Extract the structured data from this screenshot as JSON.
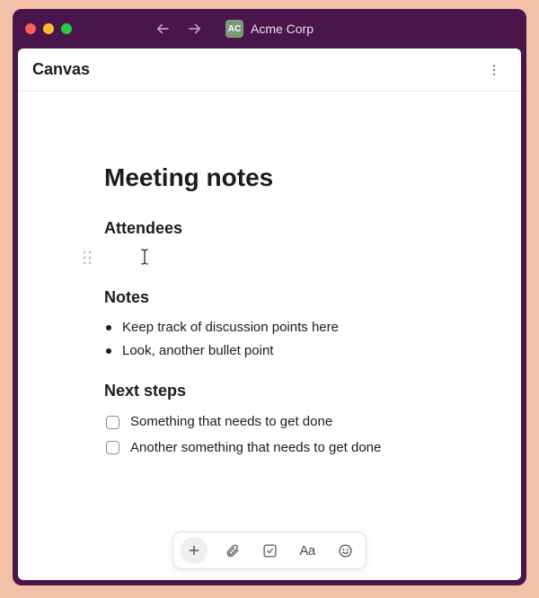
{
  "workspace": {
    "badge": "AC",
    "name": "Acme Corp"
  },
  "tab": {
    "title": "Canvas"
  },
  "document": {
    "title": "Meeting notes",
    "sections": {
      "attendees": {
        "heading": "Attendees"
      },
      "notes": {
        "heading": "Notes",
        "bullets": [
          "Keep track of discussion points here",
          "Look, another bullet point"
        ]
      },
      "next_steps": {
        "heading": "Next steps",
        "items": [
          {
            "label": "Something that needs to get done",
            "checked": false
          },
          {
            "label": "Another something that needs to get done",
            "checked": false
          }
        ]
      }
    }
  },
  "toolbar": {
    "aa_label": "Aa"
  }
}
